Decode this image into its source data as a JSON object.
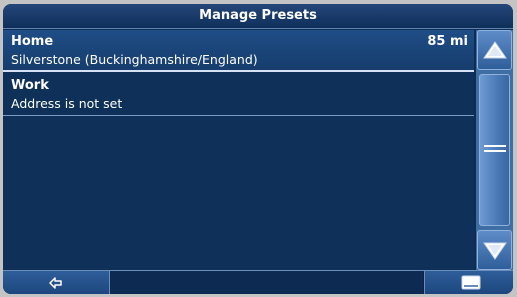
{
  "header": {
    "title": "Manage Presets"
  },
  "presets": [
    {
      "name": "Home",
      "address": "Silverstone (Buckinghamshire/England)",
      "distance": "85 mi"
    },
    {
      "name": "Work",
      "address": "Address is not set",
      "distance": ""
    }
  ],
  "scrollbar": {
    "up_icon": "triangle-up-icon",
    "thumb_icon": "grip-lines-icon",
    "down_icon": "triangle-down-icon"
  },
  "bottom_bar": {
    "back_icon": "back-arrow-icon",
    "right_icon": "keyboard-icon"
  }
}
